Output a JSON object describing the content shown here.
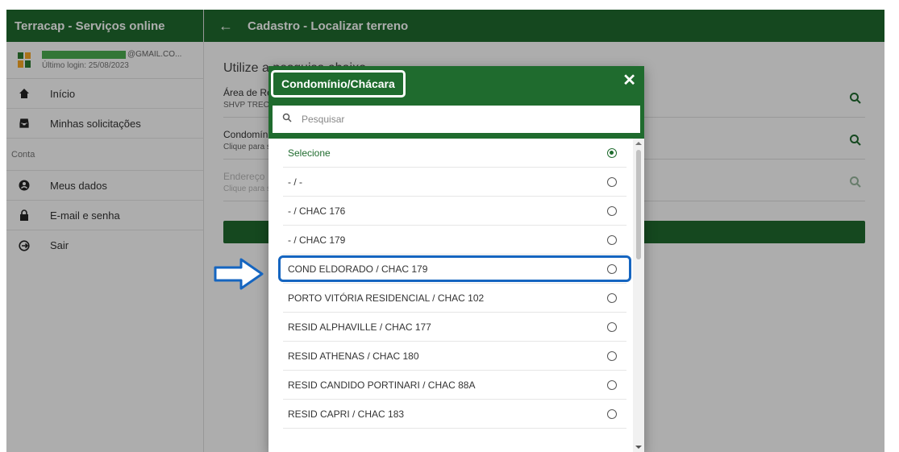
{
  "sidebar": {
    "app_title": "Terracap - Serviços online",
    "user_email_suffix": "@GMAIL.CO...",
    "last_login": "Último login: 25/08/2023",
    "items": [
      {
        "label": "Início",
        "icon": "home-icon"
      },
      {
        "label": "Minhas solicitações",
        "icon": "inbox-icon"
      }
    ],
    "section_label": "Conta",
    "account_items": [
      {
        "label": "Meus dados",
        "icon": "account-icon"
      },
      {
        "label": "E-mail e senha",
        "icon": "lock-icon"
      },
      {
        "label": "Sair",
        "icon": "logout-icon"
      }
    ]
  },
  "main": {
    "title": "Cadastro - Localizar terreno",
    "intro": "Utilize a pesquisa abaixo",
    "fields": [
      {
        "label": "Área de Regularização",
        "value": "SHVP TRECHO"
      },
      {
        "label": "Condomínio/Chácara",
        "value": "Clique para selecionar"
      },
      {
        "label": "Endereço",
        "value": "Clique para selecionar"
      }
    ]
  },
  "modal": {
    "title": "Condomínio/Chácara",
    "close": "✕",
    "search_placeholder": "Pesquisar",
    "options": [
      {
        "label": "Selecione",
        "selected": true
      },
      {
        "label": "- / -",
        "selected": false
      },
      {
        "label": "- / CHAC 176",
        "selected": false
      },
      {
        "label": "- / CHAC 179",
        "selected": false
      },
      {
        "label": "COND ELDORADO / CHAC 179",
        "selected": false,
        "highlighted": true
      },
      {
        "label": "PORTO VITÓRIA RESIDENCIAL / CHAC 102",
        "selected": false
      },
      {
        "label": "RESID ALPHAVILLE / CHAC 177",
        "selected": false
      },
      {
        "label": "RESID ATHENAS / CHAC 180",
        "selected": false
      },
      {
        "label": "RESID CANDIDO PORTINARI / CHAC 88A",
        "selected": false
      },
      {
        "label": "RESID CAPRI / CHAC 183",
        "selected": false
      }
    ]
  },
  "colors": {
    "brand_green": "#1f6b2e",
    "highlight_blue": "#1565c0"
  }
}
